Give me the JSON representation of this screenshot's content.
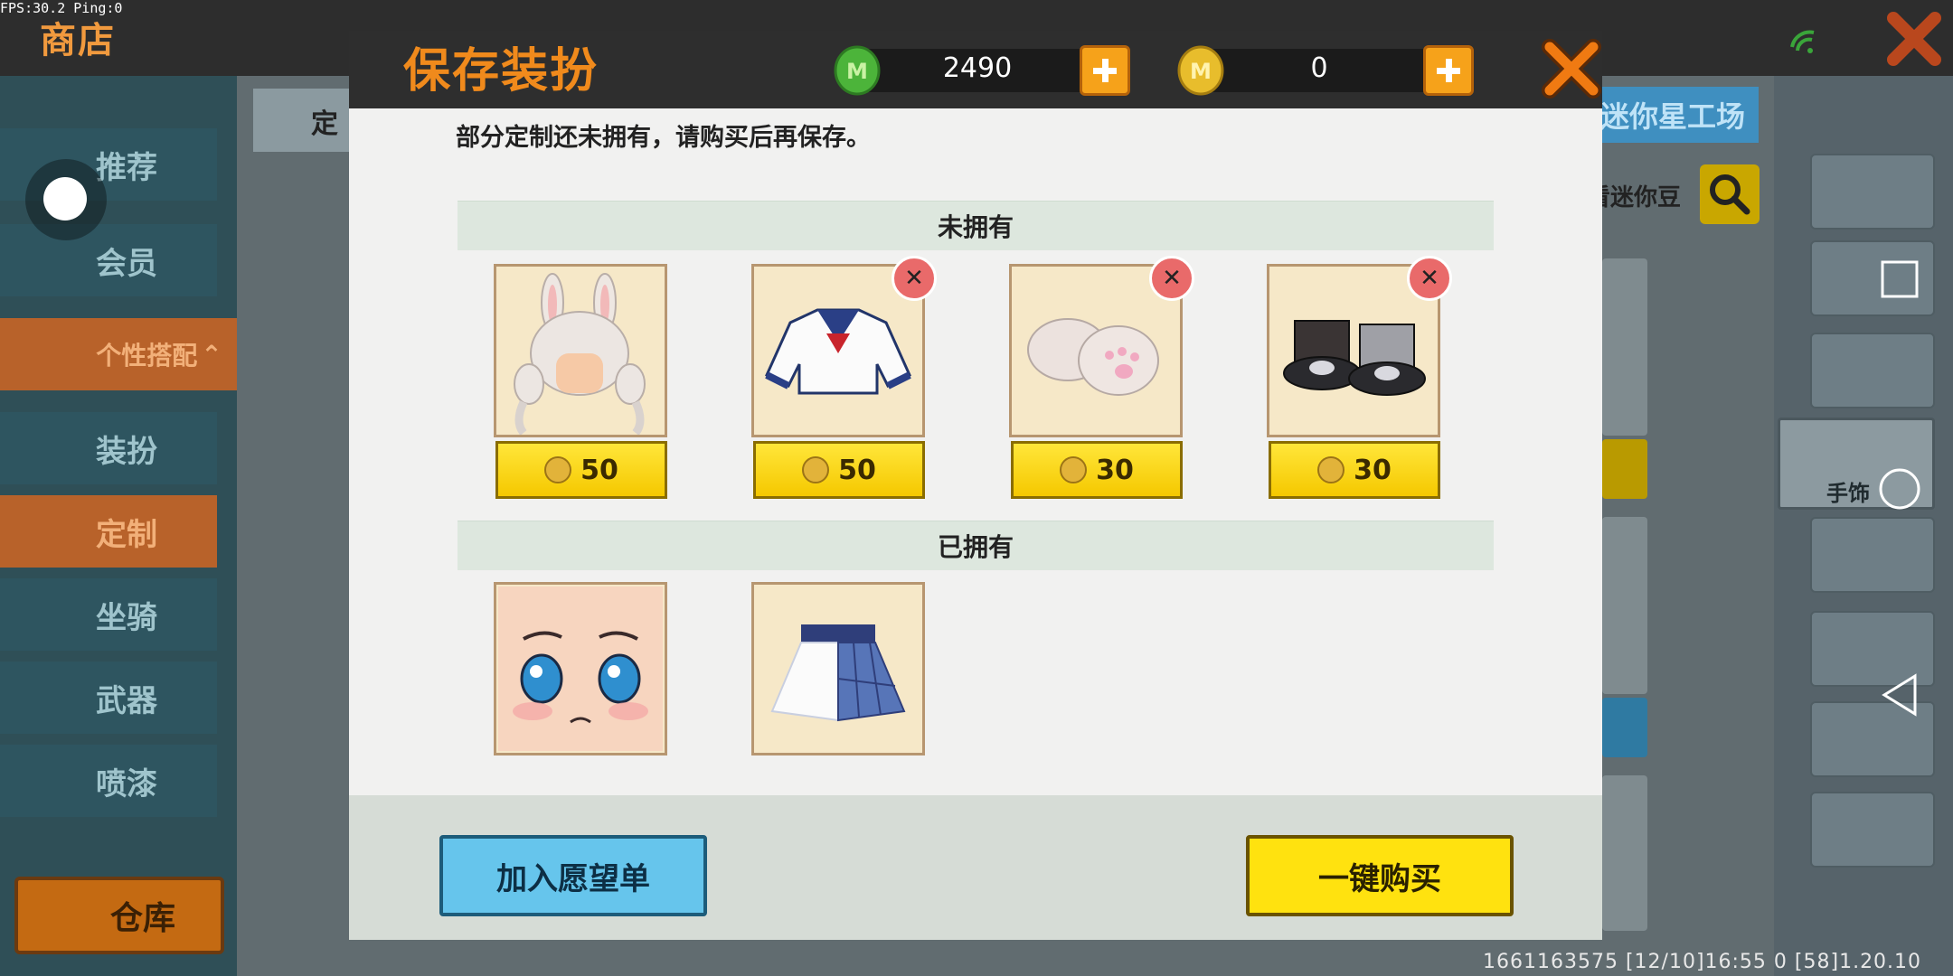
{
  "status": {
    "fps_text": "FPS:30.2  Ping:0"
  },
  "background": {
    "title": "商店",
    "tab_partial": "定",
    "workshop_label": "迷你星工场",
    "search_hint": "看迷你豆",
    "nav_items": [
      {
        "label": "推荐"
      },
      {
        "label": "会员"
      },
      {
        "label": "个性搭配"
      },
      {
        "label": "装扮"
      },
      {
        "label": "定制"
      },
      {
        "label": "坐骑"
      },
      {
        "label": "武器"
      },
      {
        "label": "喷漆"
      }
    ],
    "wardrobe_label": "仓库",
    "accessory_label": "手饰",
    "footer_text": "1661163575   [12/10]16:55 0   [58]1.20.10"
  },
  "dialog": {
    "title": "保存装扮",
    "currency": {
      "gems": {
        "value": "2490",
        "icon": "green-gem-coin-icon"
      },
      "coins": {
        "value": "0",
        "icon": "gold-coin-icon"
      }
    },
    "notice": "部分定制还未拥有，请购买后再保存。",
    "not_owned_header": "未拥有",
    "owned_header": "已拥有",
    "not_owned_items": [
      {
        "item": "bunny-ear-white-hair",
        "price": "50",
        "removable": false
      },
      {
        "item": "sailor-top",
        "price": "50",
        "removable": true
      },
      {
        "item": "cat-paw-gloves",
        "price": "30",
        "removable": true
      },
      {
        "item": "black-boots",
        "price": "30",
        "removable": true
      }
    ],
    "owned_items": [
      {
        "item": "blushing-face"
      },
      {
        "item": "plaid-skirt"
      }
    ],
    "wishlist_button": "加入愿望单",
    "buy_button": "一键购买"
  },
  "colors": {
    "accent_orange": "#f08a1c",
    "price_yellow": "#ffe20f",
    "wish_blue": "#66c5ec",
    "remove_red": "#e96a6a"
  }
}
